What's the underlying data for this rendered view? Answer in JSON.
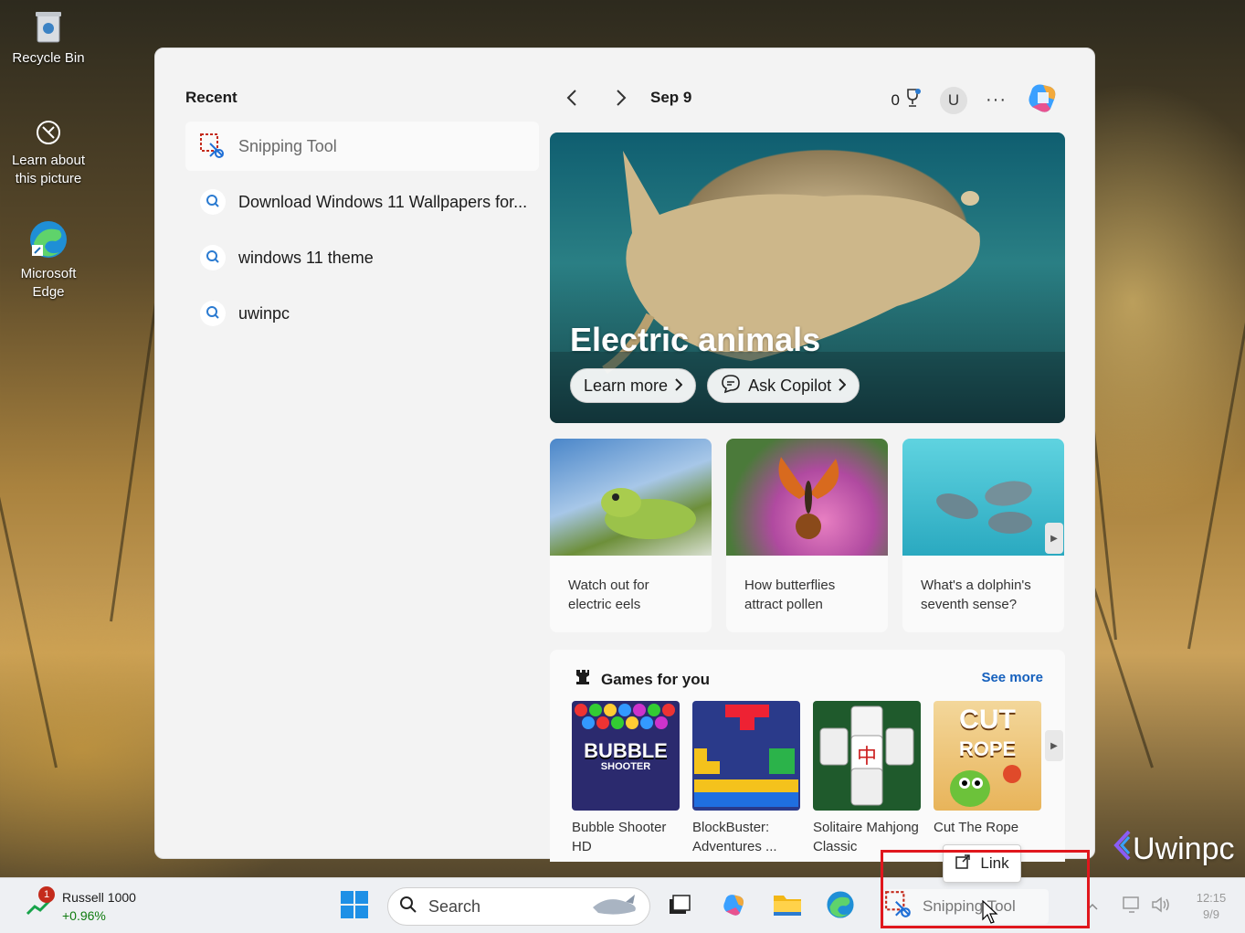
{
  "desktop": {
    "icons": [
      {
        "label": "Recycle Bin"
      },
      {
        "label": "Learn about this picture"
      },
      {
        "label": "Microsoft Edge"
      }
    ]
  },
  "panel": {
    "recent_title": "Recent",
    "recent_items": [
      {
        "label": "Snipping Tool",
        "icon": "snipping-tool-icon"
      },
      {
        "label": "Download Windows 11 Wallpapers for...",
        "icon": "search-icon"
      },
      {
        "label": "windows 11 theme",
        "icon": "search-icon"
      },
      {
        "label": "uwinpc",
        "icon": "search-icon"
      }
    ],
    "date": "Sep 9",
    "points": "0",
    "avatar": "U",
    "more": "···",
    "hero": {
      "title": "Electric animals",
      "learn_more": "Learn more",
      "ask_copilot": "Ask Copilot"
    },
    "cards": [
      {
        "caption": "Watch out for electric eels"
      },
      {
        "caption": "How butterflies attract pollen"
      },
      {
        "caption": "What's a dolphin's seventh sense?"
      }
    ],
    "games": {
      "title": "Games for you",
      "see_more": "See more",
      "items": [
        {
          "name": "Bubble Shooter HD",
          "art_text": "BUBBLE",
          "art_sub": "SHOOTER"
        },
        {
          "name": "BlockBuster: Adventures ..."
        },
        {
          "name": "Solitaire Mahjong Classic"
        },
        {
          "name": "Cut The Rope",
          "art_text": "CUT",
          "art_sub": "ROPE"
        }
      ]
    }
  },
  "taskbar": {
    "widget": {
      "badge": "1",
      "title": "Russell 1000",
      "change": "+0.96%"
    },
    "search_placeholder": "Search",
    "running_app": "Snipping Tool",
    "time": "12:15",
    "date": "9/9"
  },
  "tooltip": {
    "label": "Link"
  },
  "brand": {
    "text": "Uwinpc"
  },
  "colors": {
    "accent": "#1560bd",
    "highlight": "#e0171d",
    "positive": "#0f7b0f"
  }
}
